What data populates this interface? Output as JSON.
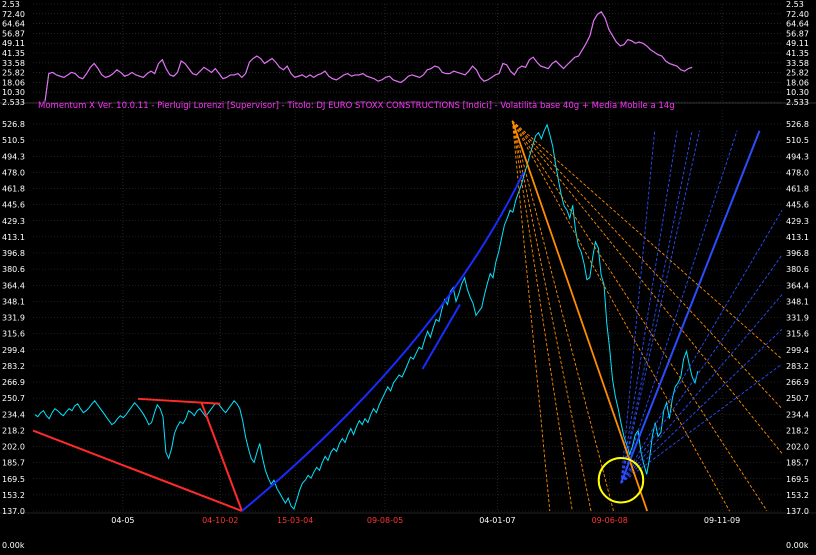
{
  "header": {
    "title": "Momentum X  Ver. 10.0.11  -  Pierluigi Lorenzi  [Supervisor] - Titolo: DJ EURO STOXX CONSTRUCTIONS  [Indici] - Volatilità base 40g + Media Mobile a 14g"
  },
  "colors": {
    "background": "#000000",
    "grid": "#3a3a3a",
    "axis_text": "#ffffff",
    "price": "#00e5ff",
    "trend_red": "#ff2a2a",
    "trend_blue": "#1a2bff",
    "fan_orange": "#ff8c00",
    "fan_blue": "#2a4dff",
    "highlight": "#ffff00",
    "title": "#ff33ff",
    "date_red": "#ff3333",
    "date_white": "#ffffff",
    "volatility": "#b8c8ff",
    "moving_average": "#ff55ff"
  },
  "chart_data": [
    {
      "type": "line",
      "panel": "volatility",
      "y_ticks_left": [
        "2.53",
        "72.40",
        "64.64",
        "56.87",
        "49.11",
        "41.35",
        "33.58",
        "25.82",
        "18.06",
        "10.30",
        "2.533"
      ],
      "y_ticks_right": [
        "2.53",
        "72.40",
        "64.64",
        "56.87",
        "49.11",
        "41.35",
        "33.58",
        "25.82",
        "18.06",
        "10.30",
        "2.533"
      ],
      "ylim": [
        2.533,
        80.16
      ],
      "series": [
        {
          "role": "volatility",
          "values": [
            3,
            25,
            26,
            24,
            23,
            22,
            24,
            26,
            25,
            22,
            21,
            25,
            30,
            33,
            29,
            24,
            22,
            23,
            25,
            28,
            26,
            23,
            24,
            26,
            24,
            23,
            22,
            25,
            27,
            25,
            33,
            36,
            29,
            24,
            23,
            26,
            35,
            33,
            29,
            25,
            24,
            27,
            30,
            28,
            26,
            29,
            25,
            21,
            22,
            24,
            24,
            25,
            22,
            25,
            34,
            37,
            39,
            37,
            33,
            35,
            37,
            34,
            30,
            28,
            31,
            25,
            22,
            23,
            24,
            22,
            24,
            22,
            24,
            25,
            27,
            23,
            21,
            20,
            22,
            24,
            25,
            23,
            24,
            24,
            25,
            23,
            22,
            21,
            19,
            20,
            22,
            23,
            20,
            19,
            18,
            20,
            23,
            24,
            23,
            22,
            24,
            28,
            29,
            31,
            30,
            26,
            25,
            25,
            27,
            26,
            25,
            24,
            27,
            31,
            28,
            22,
            19,
            20,
            22,
            24,
            25,
            33,
            32,
            27,
            24,
            29,
            31,
            30,
            36,
            38,
            34,
            31,
            30,
            29,
            33,
            35,
            32,
            29,
            32,
            35,
            38,
            39,
            44,
            49,
            55,
            67,
            72,
            74,
            69,
            60,
            55,
            50,
            47,
            48,
            52,
            51,
            49,
            50,
            49,
            47,
            44,
            42,
            40,
            39,
            35,
            33,
            32,
            31,
            28,
            27,
            29,
            30
          ]
        },
        {
          "role": "moving_average",
          "values": [
            3,
            25,
            26,
            24,
            23,
            22,
            24,
            26,
            25,
            22,
            21,
            25,
            30,
            33,
            29,
            24,
            22,
            23,
            25,
            28,
            26,
            23,
            24,
            26,
            24,
            23,
            22,
            25,
            27,
            25,
            33,
            36,
            29,
            24,
            23,
            26,
            35,
            33,
            29,
            25,
            24,
            27,
            30,
            28,
            26,
            29,
            25,
            21,
            22,
            24,
            24,
            25,
            22,
            25,
            34,
            37,
            39,
            37,
            33,
            35,
            37,
            34,
            30,
            28,
            31,
            25,
            22,
            23,
            24,
            22,
            24,
            22,
            24,
            25,
            27,
            23,
            21,
            20,
            22,
            24,
            25,
            23,
            24,
            24,
            25,
            23,
            22,
            21,
            19,
            20,
            22,
            23,
            20,
            19,
            18,
            20,
            23,
            24,
            23,
            22,
            24,
            28,
            29,
            31,
            30,
            26,
            25,
            25,
            27,
            26,
            25,
            24,
            27,
            31,
            28,
            22,
            19,
            20,
            22,
            24,
            25,
            33,
            32,
            27,
            24,
            29,
            31,
            30,
            36,
            38,
            34,
            31,
            30,
            29,
            33,
            35,
            32,
            29,
            32,
            35,
            38,
            39,
            44,
            49,
            55,
            67,
            72,
            74,
            69,
            60,
            55,
            50,
            47,
            48,
            52,
            51,
            49,
            50,
            49,
            47,
            44,
            42,
            40,
            39,
            35,
            33,
            32,
            31,
            28,
            27,
            29,
            30
          ]
        }
      ]
    },
    {
      "type": "line",
      "panel": "price",
      "y_ticks_left": [
        "526.8",
        "510.5",
        "494.3",
        "478.0",
        "461.8",
        "445.6",
        "429.3",
        "413.1",
        "396.8",
        "380.6",
        "364.4",
        "348.1",
        "331.9",
        "315.6",
        "299.4",
        "283.2",
        "266.9",
        "250.7",
        "234.4",
        "218.2",
        "202.0",
        "185.7",
        "169.5",
        "153.2",
        "137.0"
      ],
      "y_ticks_right": [
        "526.8",
        "510.5",
        "494.3",
        "478.0",
        "461.8",
        "445.6",
        "429.3",
        "413.1",
        "396.8",
        "380.6",
        "364.4",
        "348.1",
        "331.9",
        "315.6",
        "299.4",
        "283.2",
        "266.9",
        "250.7",
        "234.4",
        "218.2",
        "202.0",
        "185.7",
        "169.5",
        "153.2",
        "137.0"
      ],
      "ylim": [
        137.0,
        538
      ],
      "x_ticks": [
        {
          "label": "04-05",
          "color": "white"
        },
        {
          "label": "04-10-02",
          "color": "red"
        },
        {
          "label": "15-03-04",
          "color": "red"
        },
        {
          "label": "09-08-05",
          "color": "red"
        },
        {
          "label": "04-01-07",
          "color": "white"
        },
        {
          "label": "09-06-08",
          "color": "red"
        },
        {
          "label": "09-11-09",
          "color": "white"
        }
      ],
      "x_tick_positions": [
        0.12,
        0.25,
        0.35,
        0.47,
        0.62,
        0.77,
        0.92
      ],
      "series": [
        {
          "role": "price",
          "values": [
            234,
            232,
            236,
            238,
            233,
            230,
            236,
            240,
            238,
            235,
            233,
            237,
            240,
            238,
            243,
            245,
            240,
            236,
            238,
            241,
            245,
            248,
            244,
            240,
            236,
            232,
            228,
            224,
            226,
            230,
            233,
            231,
            234,
            238,
            242,
            246,
            243,
            239,
            235,
            230,
            224,
            226,
            236,
            244,
            240,
            232,
            196,
            190,
            200,
            215,
            222,
            227,
            225,
            230,
            238,
            236,
            233,
            238,
            240,
            236,
            232,
            236,
            240,
            244,
            246,
            243,
            239,
            236,
            240,
            244,
            248,
            245,
            240,
            228,
            212,
            200,
            190,
            186,
            196,
            205,
            190,
            178,
            170,
            164,
            168,
            160,
            155,
            150,
            145,
            150,
            142,
            139,
            148,
            158,
            165,
            168,
            173,
            170,
            176,
            181,
            178,
            186,
            192,
            188,
            196,
            200,
            197,
            205,
            210,
            206,
            214,
            220,
            214,
            222,
            228,
            224,
            230,
            226,
            234,
            240,
            236,
            244,
            250,
            256,
            262,
            258,
            266,
            270,
            274,
            272,
            278,
            285,
            292,
            290,
            296,
            302,
            300,
            310,
            318,
            312,
            322,
            330,
            328,
            340,
            350,
            345,
            358,
            362,
            348,
            356,
            366,
            372,
            360,
            352,
            346,
            334,
            338,
            342,
            355,
            366,
            376,
            372,
            388,
            398,
            412,
            425,
            432,
            440,
            438,
            450,
            458,
            466,
            476,
            486,
            496,
            506,
            515,
            518,
            512,
            520,
            526,
            516,
            504,
            486,
            470,
            455,
            444,
            440,
            432,
            445,
            420,
            404,
            398,
            386,
            370,
            372,
            392,
            408,
            402,
            375,
            365,
            326,
            300,
            270,
            252,
            240,
            225,
            212,
            204,
            194,
            202,
            214,
            218,
            196,
            184,
            174,
            190,
            212,
            226,
            212,
            216,
            238,
            246,
            230,
            250,
            262,
            266,
            272,
            290,
            298,
            284,
            272,
            266,
            278
          ],
          "xlim": [
            0,
            1
          ]
        }
      ],
      "trendlines": [
        {
          "role": "red-support",
          "from": [
            0.0,
            218
          ],
          "to": [
            0.279,
            137
          ]
        },
        {
          "role": "red-resistance",
          "from": [
            0.14,
            250
          ],
          "to": [
            0.25,
            245
          ]
        },
        {
          "role": "red-breakdown",
          "from": [
            0.225,
            246
          ],
          "to": [
            0.279,
            137
          ]
        },
        {
          "role": "blue-uptrend",
          "from": [
            0.279,
            137
          ],
          "to": [
            0.655,
            478
          ]
        }
      ],
      "fans": [
        {
          "role": "orange-fan",
          "origin": [
            0.64,
            530
          ],
          "targets": [
            [
              0.69,
              137
            ],
            [
              0.72,
              137
            ],
            [
              0.745,
              137
            ],
            [
              0.775,
              137
            ],
            [
              0.82,
              137
            ],
            [
              0.93,
              137
            ],
            [
              0.98,
              137
            ],
            [
              1.0,
              195
            ],
            [
              1.0,
              240
            ],
            [
              1.0,
              290
            ]
          ]
        },
        {
          "role": "blue-fan",
          "origin": [
            0.785,
            165
          ],
          "targets": [
            [
              0.83,
              520
            ],
            [
              0.86,
              520
            ],
            [
              0.88,
              520
            ],
            [
              0.89,
              520
            ],
            [
              0.94,
              520
            ],
            [
              1.0,
              440
            ],
            [
              1.0,
              395
            ],
            [
              1.0,
              355
            ],
            [
              1.0,
              320
            ],
            [
              1.0,
              285
            ]
          ]
        }
      ],
      "highlight_circle": {
        "center": [
          0.785,
          168
        ],
        "radius_value": 14
      }
    }
  ],
  "bottom_axis": {
    "left": "0.00k",
    "right": "0.00k"
  }
}
